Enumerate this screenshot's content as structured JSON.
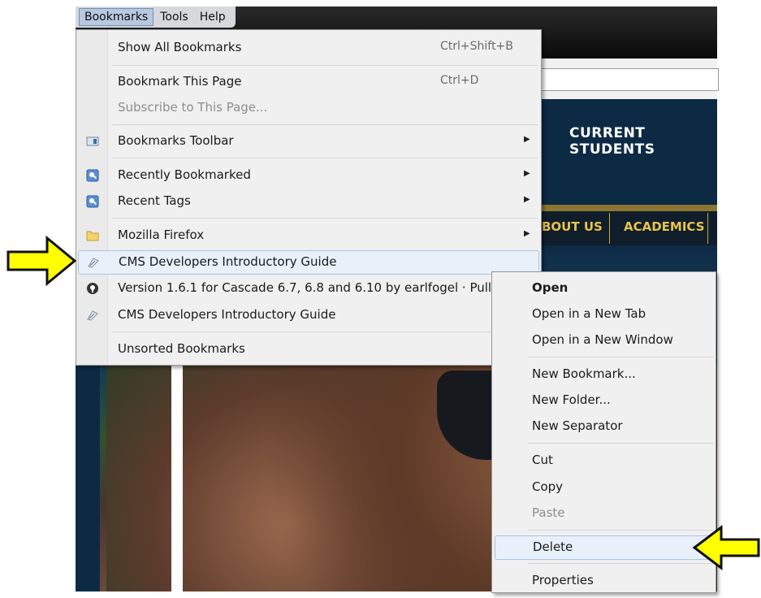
{
  "menubar": {
    "items": [
      "Bookmarks",
      "Tools",
      "Help"
    ]
  },
  "website": {
    "header_link": "CURRENT STUDENTS",
    "nav_items": [
      "BOUT US",
      "ACADEMICS"
    ]
  },
  "bookmarks_menu": {
    "show_all": {
      "label": "Show All Bookmarks",
      "shortcut": "Ctrl+Shift+B"
    },
    "bookmark_page": {
      "label": "Bookmark This Page",
      "shortcut": "Ctrl+D"
    },
    "subscribe": {
      "label": "Subscribe to This Page..."
    },
    "toolbar": {
      "label": "Bookmarks Toolbar"
    },
    "recently": {
      "label": "Recently Bookmarked"
    },
    "recent_tags": {
      "label": "Recent Tags"
    },
    "mozilla": {
      "label": "Mozilla Firefox"
    },
    "cms_guide_1": {
      "label": "CMS Developers Introductory Guide"
    },
    "version": {
      "label": "Version 1.6.1 for Cascade 6.7, 6.8 and 6.10 by earlfogel · Pull"
    },
    "cms_guide_2": {
      "label": "CMS Developers Introductory Guide"
    },
    "unsorted": {
      "label": "Unsorted Bookmarks"
    }
  },
  "context_menu": {
    "open": "Open",
    "open_tab": "Open in a New Tab",
    "open_window": "Open in a New Window",
    "new_bookmark": "New Bookmark...",
    "new_folder": "New Folder...",
    "new_separator": "New Separator",
    "cut": "Cut",
    "copy": "Copy",
    "paste": "Paste",
    "delete": "Delete",
    "properties": "Properties"
  },
  "colors": {
    "annotation_arrow": "#ffff00",
    "site_navy": "#0d2a45",
    "site_gold": "#e8c44a"
  }
}
